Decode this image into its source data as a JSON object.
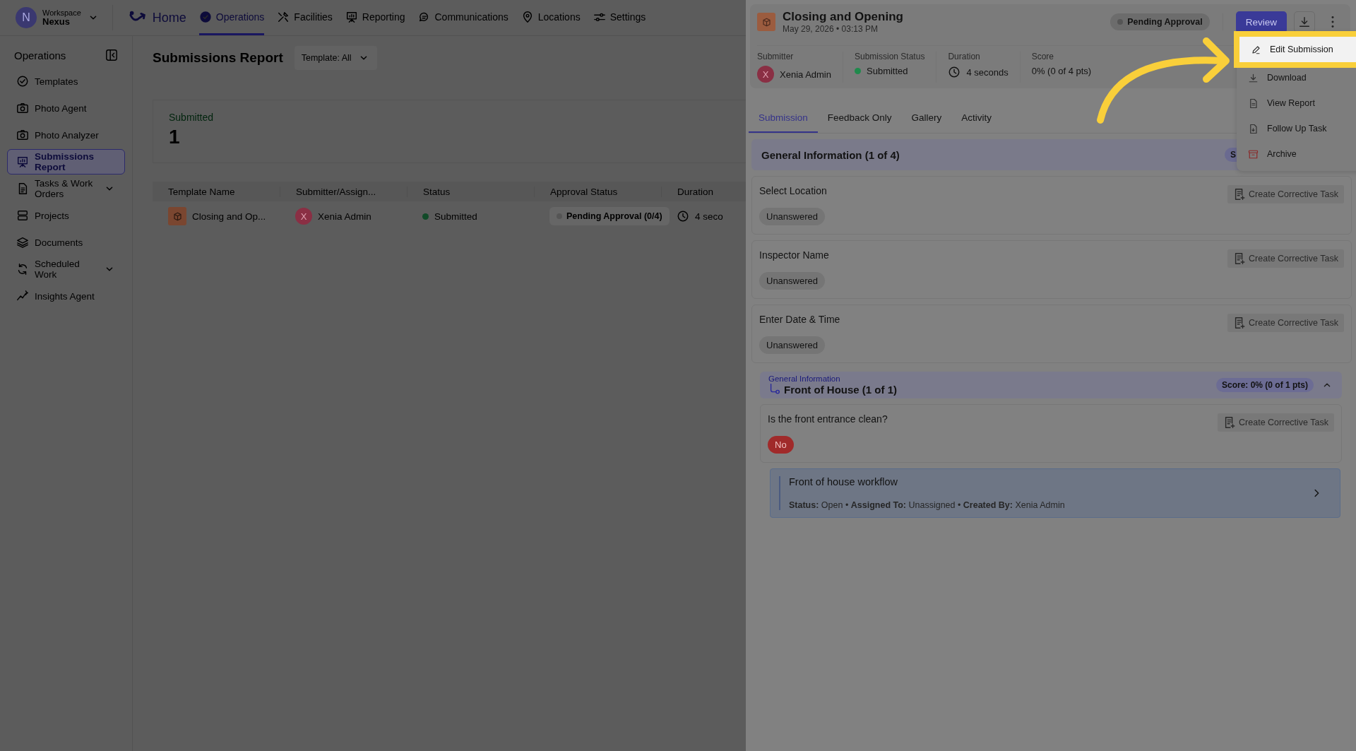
{
  "nav": {
    "workspace": {
      "initial": "N",
      "label": "Workspace",
      "name": "Nexus"
    },
    "home": "Home",
    "items": [
      {
        "label": "Operations",
        "selected": true
      },
      {
        "label": "Facilities",
        "selected": false
      },
      {
        "label": "Reporting",
        "selected": false
      },
      {
        "label": "Communications",
        "selected": false
      },
      {
        "label": "Locations",
        "selected": false
      },
      {
        "label": "Settings",
        "selected": false
      }
    ]
  },
  "sidebar": {
    "title": "Operations",
    "items": [
      {
        "label": "Templates",
        "selected": false,
        "expandable": false
      },
      {
        "label": "Photo Agent",
        "selected": false,
        "expandable": false
      },
      {
        "label": "Photo Analyzer",
        "selected": false,
        "expandable": false
      },
      {
        "label": "Submissions Report",
        "selected": true,
        "expandable": false
      },
      {
        "label": "Tasks & Work Orders",
        "selected": false,
        "expandable": true
      },
      {
        "label": "Projects",
        "selected": false,
        "expandable": false
      },
      {
        "label": "Documents",
        "selected": false,
        "expandable": false
      },
      {
        "label": "Scheduled Work",
        "selected": false,
        "expandable": true
      },
      {
        "label": "Insights Agent",
        "selected": false,
        "expandable": false
      }
    ]
  },
  "report": {
    "title": "Submissions Report",
    "filter": "Template: All",
    "summary": {
      "label": "Submitted",
      "value": "1"
    },
    "table": {
      "columns": [
        "Template Name",
        "Submitter/Assign...",
        "Status",
        "Approval Status",
        "Duration"
      ],
      "rows": [
        {
          "template": "Closing and Op...",
          "submitter": "Xenia Admin",
          "submitter_initial": "X",
          "status": "Submitted",
          "approval": "Pending Approval (0/4)",
          "duration": "4 seco"
        }
      ]
    }
  },
  "panel": {
    "title": "Closing and Opening",
    "date": "May 29, 2026 • 03:13 PM",
    "badge": "Pending Approval",
    "review": "Review",
    "meta": [
      {
        "kind": "person",
        "label": "Submitter",
        "value": "Xenia Admin",
        "initial": "X"
      },
      {
        "kind": "status",
        "label": "Submission Status",
        "value": "Submitted",
        "color": "#1f8a4c"
      },
      {
        "kind": "time",
        "label": "Duration",
        "value": "4 seconds"
      },
      {
        "kind": "plain",
        "label": "Score",
        "value": "0% (0 of 4 pts)"
      }
    ],
    "tabs": [
      {
        "label": "Submission",
        "selected": true
      },
      {
        "label": "Feedback Only",
        "selected": false
      },
      {
        "label": "Gallery",
        "selected": false
      },
      {
        "label": "Activity",
        "selected": false
      }
    ],
    "menu": [
      {
        "kind": "edit",
        "label": "Edit Submission",
        "highlighted": true
      },
      {
        "kind": "download",
        "label": "Download",
        "highlighted": false
      },
      {
        "kind": "report",
        "label": "View Report",
        "highlighted": false
      },
      {
        "kind": "task",
        "label": "Follow Up Task",
        "highlighted": false
      },
      {
        "kind": "archive",
        "label": "Archive",
        "highlighted": false
      }
    ],
    "section": {
      "title": "General Information (1 of 4)",
      "score_badge": "S"
    },
    "questions": [
      {
        "label": "Select Location",
        "answer": "Unanswered",
        "action": "Create Corrective Task"
      },
      {
        "label": "Inspector Name",
        "answer": "Unanswered",
        "action": "Create Corrective Task"
      },
      {
        "label": "Enter Date & Time",
        "answer": "Unanswered",
        "action": "Create Corrective Task"
      }
    ],
    "subsection": {
      "parent": "General Information",
      "title": "Front of House (1 of 1)",
      "score": "Score: 0% (0 of 1 pts)",
      "expanded": true,
      "question": {
        "label": "Is the front entrance clean?",
        "answer": "No",
        "negative": true,
        "action": "Create Corrective Task"
      },
      "task": {
        "title": "Front of house workflow",
        "details": "**Status:** Open • **Assigned To:**  Unassigned • **Created By:** Xenia Admin"
      }
    }
  }
}
